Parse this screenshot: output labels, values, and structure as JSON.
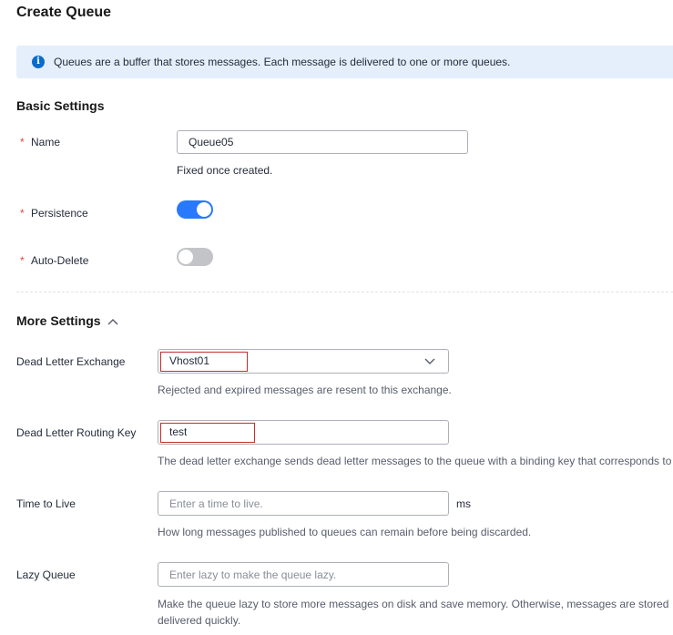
{
  "page": {
    "title": "Create Queue"
  },
  "banner": {
    "icon": "info-icon",
    "text": "Queues are a buffer that stores messages. Each message is delivered to one or more queues."
  },
  "basic": {
    "title": "Basic Settings",
    "required_mark": "*",
    "name_label": "Name",
    "name_value": "Queue05",
    "name_hint": "Fixed once created.",
    "persistence_label": "Persistence",
    "persistence_on": true,
    "auto_delete_label": "Auto-Delete",
    "auto_delete_on": false
  },
  "more": {
    "title": "More Settings",
    "toggle_icon": "chevron-up-icon",
    "dlx_label": "Dead Letter Exchange",
    "dlx_value": "Vhost01",
    "dlx_hint": "Rejected and expired messages are resent to this exchange.",
    "dlrk_label": "Dead Letter Routing Key",
    "dlrk_value": "test",
    "dlrk_hint": "The dead letter exchange sends dead letter messages to the queue with a binding key that corresponds to",
    "ttl_label": "Time to Live",
    "ttl_placeholder": "Enter a time to live.",
    "ttl_unit": "ms",
    "ttl_hint": "How long messages published to queues can remain before being discarded.",
    "lazy_label": "Lazy Queue",
    "lazy_placeholder": "Enter lazy to make the queue lazy.",
    "lazy_hint_line1": "Make the queue lazy to store more messages on disk and save memory. Otherwise, messages are stored",
    "lazy_hint_line2": "delivered quickly."
  },
  "colors": {
    "accent": "#2979ff",
    "banner_bg": "#e4effb",
    "required": "#e54545",
    "highlight": "#c72a2a"
  }
}
